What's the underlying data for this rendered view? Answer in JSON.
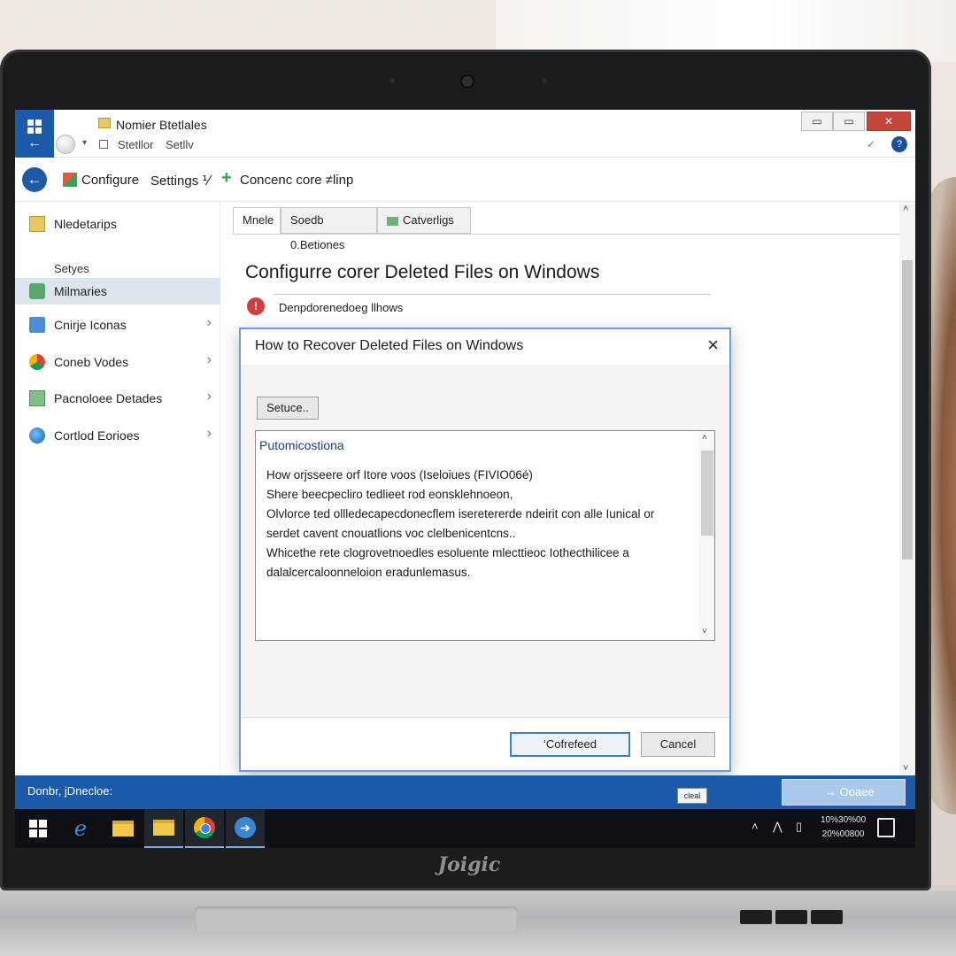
{
  "window": {
    "title": "Nomier Btetlales",
    "sub_left": "Stetllor",
    "sub_right": "Setllv",
    "minimize": "▭",
    "maximize": "▭",
    "close": "✕"
  },
  "toolbar": {
    "configure": "Configure",
    "settings": "Settings ⅟",
    "conceal": "Concenc core ≠linp"
  },
  "sidebar": {
    "top_item": "Nledetarips",
    "heading": "Setyes",
    "items": [
      {
        "label": "Milmaries",
        "active": true,
        "chevron": false
      },
      {
        "label": "Cnirje Iconas",
        "active": false,
        "chevron": true
      },
      {
        "label": "Coneb Vodes",
        "active": false,
        "chevron": true
      },
      {
        "label": "Pacnoloee Detades",
        "active": false,
        "chevron": true
      },
      {
        "label": "Cortlod Eorioes",
        "active": false,
        "chevron": true
      }
    ]
  },
  "tabs": [
    {
      "label": "Mnele"
    },
    {
      "label": "Soedb 0.Betiones"
    },
    {
      "label": "Catverligs"
    }
  ],
  "main": {
    "page_title": "Configurre corer Deleted Files on Windows",
    "alert_text": "Denpdorenedoeg llhows"
  },
  "dialog": {
    "title": "How to Recover Deleted Files on Windows",
    "setup_button": "Setuce..",
    "header": "Putomicostiona",
    "lines": [
      "How orjsseere orf Itore voos (Iseloiues (FIVIO06é)",
      "Shere beecpecliro tedlieet rod eonsklehnoeon,",
      "Olvlorce ted ollledecapecdonecflem iseretererde ndeirit con alle Iunical or",
      "serdet cavent cnouatlions voc clelbenicentcns..",
      "Whicethe rete clogrovetnoedles esoluente mlecttieoc Iothecthilicee a",
      "dalalcercaloonneloion eradunlemasus."
    ],
    "ok_label": "‘Cofrefeed",
    "cancel_label": "Cancel"
  },
  "statusbar": {
    "text": "Donbr, jDnecloe:",
    "badge": "cleal",
    "button": "→ Ooaee"
  },
  "taskbar": {
    "clock_top": "10%30%00",
    "clock_bottom": "20%00800"
  },
  "laptop": {
    "brand": "Joigic"
  },
  "colors": {
    "accent": "#1b5aa8",
    "dialog_border": "#6a9fd4",
    "ok_border": "#3d80c4"
  }
}
